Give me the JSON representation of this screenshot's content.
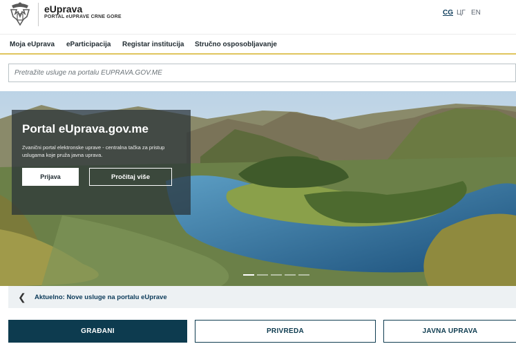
{
  "header": {
    "brand_title": "eUprava",
    "brand_subtitle": "PORTAL eUPRAVE CRNE GORE",
    "languages": [
      {
        "label": "CG",
        "active": true
      },
      {
        "label": "ЦГ",
        "active": false
      },
      {
        "label": "EN",
        "active": false
      }
    ],
    "logo_icon": "montenegro-coat-of-arms-icon"
  },
  "nav": {
    "items": [
      "Moja eUprava",
      "eParticipacija",
      "Registar institucija",
      "Stručno osposobljavanje"
    ],
    "underline_color": "#e0c55d"
  },
  "search": {
    "placeholder": "Pretražite usluge na portalu EUPRAVA.GOV.ME",
    "value": ""
  },
  "hero": {
    "title": "Portal eUprava.gov.me",
    "description": "Zvanični portal elektronske uprave - centralna tačka za pristup uslugama koje pruža javna uprava.",
    "login_button": "Prijava",
    "more_button": "Pročitaj više",
    "slide_count": 5,
    "active_slide": 1
  },
  "news": {
    "chevron_icon": "chevron-left-icon",
    "text": "Aktuelno: Nove usluge na portalu eUprave"
  },
  "categories": {
    "items": [
      "GRAĐANI",
      "PRIVREDA",
      "JAVNA UPRAVA"
    ],
    "active_index": 0,
    "primary_color": "#0d3b4f"
  }
}
